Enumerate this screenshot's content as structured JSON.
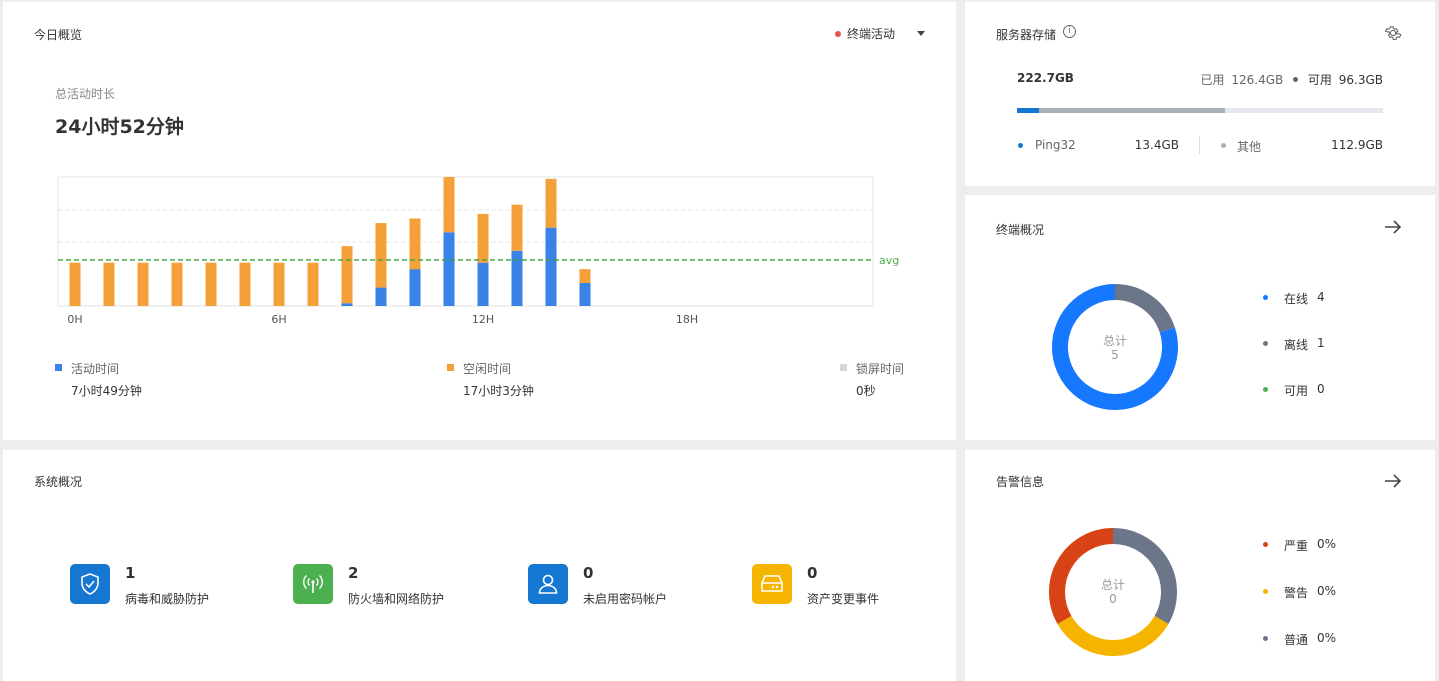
{
  "today": {
    "title": "今日概览",
    "filter_label": "终端活动",
    "total_label": "总活动时长",
    "total_value": "24小时52分钟",
    "legend": [
      {
        "label": "活动时间",
        "value": "7小时49分钟",
        "color": "#3b82e6"
      },
      {
        "label": "空闲时间",
        "value": "17小时3分钟",
        "color": "#f5a13a"
      },
      {
        "label": "锁屏时间",
        "value": "0秒",
        "color": "#d6d6d6"
      }
    ]
  },
  "chart_data": {
    "type": "bar",
    "stacked": true,
    "x_tick_labels": [
      "0H",
      "6H",
      "12H",
      "18H"
    ],
    "categories": [
      "0",
      "1",
      "2",
      "3",
      "4",
      "5",
      "6",
      "7",
      "8",
      "9",
      "10",
      "11",
      "12",
      "13",
      "14",
      "15",
      "16",
      "17",
      "18",
      "19",
      "20",
      "21",
      "22",
      "23"
    ],
    "series": [
      {
        "name": "活动时间",
        "color": "#3b82e6",
        "values": [
          0,
          0,
          0,
          0,
          0,
          0,
          0,
          0,
          0.03,
          0.2,
          0.4,
          0.8,
          0.47,
          0.6,
          0.85,
          0.25,
          0,
          0,
          0,
          0,
          0,
          0,
          0,
          0
        ]
      },
      {
        "name": "空闲时间",
        "color": "#f5a13a",
        "values": [
          0.47,
          0.47,
          0.47,
          0.47,
          0.47,
          0.47,
          0.47,
          0.47,
          0.62,
          0.7,
          0.55,
          0.6,
          0.53,
          0.5,
          0.53,
          0.15,
          0,
          0,
          0,
          0,
          0,
          0,
          0,
          0
        ]
      }
    ],
    "avg_label": "avg",
    "avg_value": 0.5,
    "ylim": [
      0,
      1.4
    ],
    "grid": true
  },
  "storage": {
    "title": "服务器存储",
    "total": "222.7GB",
    "used_label": "已用",
    "used_value": "126.4GB",
    "free_label": "可用",
    "free_value": "96.3GB",
    "used_fraction": 0.568,
    "ping_fraction": 0.06,
    "items": [
      {
        "label": "Ping32",
        "value": "13.4GB",
        "color": "#1677d2"
      },
      {
        "label": "其他",
        "value": "112.9GB",
        "color": "#a8b0bb"
      }
    ]
  },
  "endpoints": {
    "title": "终端概况",
    "center_label": "总计",
    "center_value": "5",
    "items": [
      {
        "label": "在线",
        "value": "4",
        "color": "#1677ff"
      },
      {
        "label": "离线",
        "value": "1",
        "color": "#6b7789"
      },
      {
        "label": "可用",
        "value": "0",
        "color": "#4caf50"
      }
    ]
  },
  "system": {
    "title": "系统概况",
    "items": [
      {
        "value": "1",
        "label": "病毒和威胁防护",
        "color": "#1677d2",
        "icon": "shield-icon"
      },
      {
        "value": "2",
        "label": "防火墙和网络防护",
        "color": "#4caf50",
        "icon": "antenna-icon"
      },
      {
        "value": "0",
        "label": "未启用密码帐户",
        "color": "#1677d2",
        "icon": "user-icon"
      },
      {
        "value": "0",
        "label": "资产变更事件",
        "color": "#f5b400",
        "icon": "drive-icon"
      }
    ]
  },
  "alerts": {
    "title": "告警信息",
    "center_label": "总计",
    "center_value": "0",
    "items": [
      {
        "label": "严重",
        "value": "0%",
        "color": "#d84315"
      },
      {
        "label": "警告",
        "value": "0%",
        "color": "#f5b400"
      },
      {
        "label": "普通",
        "value": "0%",
        "color": "#6b7789"
      }
    ]
  }
}
